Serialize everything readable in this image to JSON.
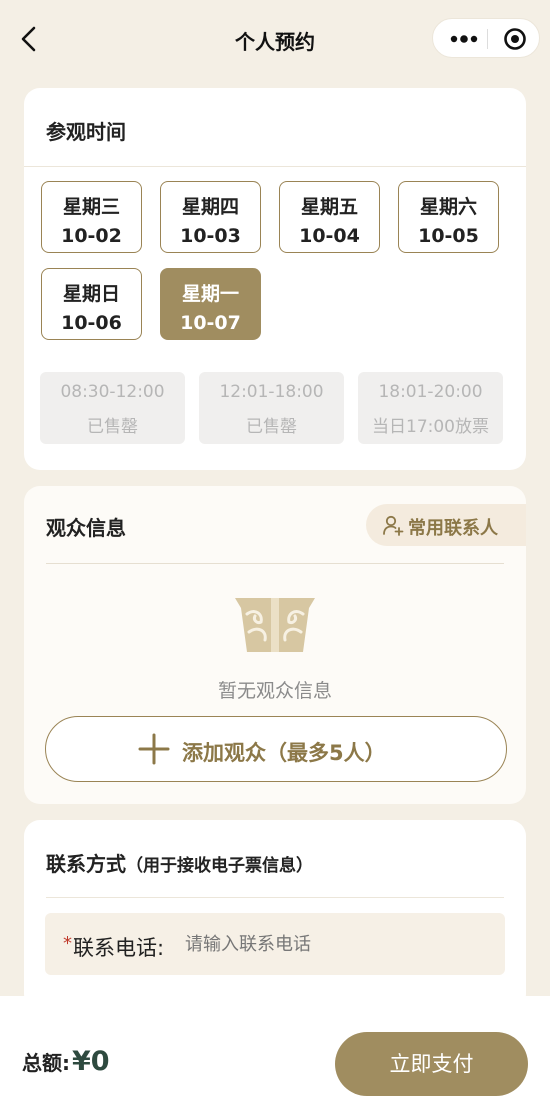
{
  "nav": {
    "title": "个人预约"
  },
  "visit": {
    "title": "参观时间",
    "dates": [
      {
        "weekday": "星期三",
        "date": "10-02",
        "selected": false
      },
      {
        "weekday": "星期四",
        "date": "10-03",
        "selected": false
      },
      {
        "weekday": "星期五",
        "date": "10-04",
        "selected": false
      },
      {
        "weekday": "星期六",
        "date": "10-05",
        "selected": false
      },
      {
        "weekday": "星期日",
        "date": "10-06",
        "selected": false
      },
      {
        "weekday": "星期一",
        "date": "10-07",
        "selected": true
      }
    ],
    "slots": [
      {
        "time": "08:30-12:00",
        "status": "已售罄"
      },
      {
        "time": "12:01-18:00",
        "status": "已售罄"
      },
      {
        "time": "18:01-20:00",
        "status": "当日17:00放票"
      }
    ]
  },
  "audience": {
    "title": "观众信息",
    "contacts_button": "常用联系人",
    "empty_text": "暂无观众信息",
    "add_button": "添加观众（最多5人）"
  },
  "contact": {
    "title": "联系方式",
    "subtitle": "（用于接收电子票信息）",
    "required_mark": "*",
    "phone_label": "联系电话:",
    "phone_placeholder": "请输入联系电话",
    "phone_value": ""
  },
  "footer": {
    "total_label": "总额:",
    "total_amount": "¥0",
    "pay_button": "立即支付"
  },
  "colors": {
    "accent": "#a08d60",
    "page_bg": "#f4efe5",
    "amount": "#2e4a3f",
    "required": "#c0392b"
  }
}
